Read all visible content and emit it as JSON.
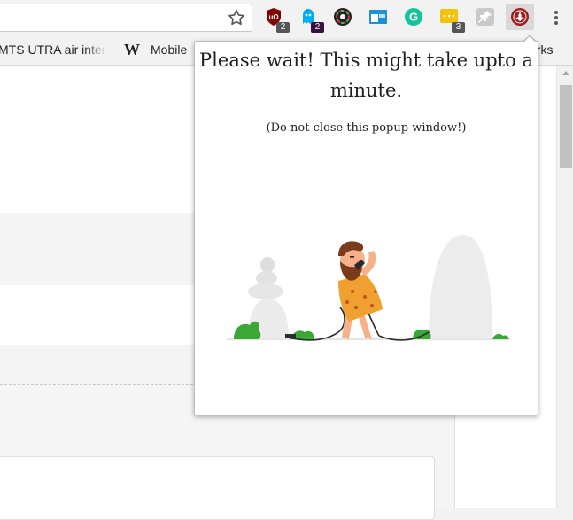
{
  "toolbar": {
    "bookmark_star": "star-icon",
    "extensions": [
      {
        "name": "ublock-origin",
        "badge": "2",
        "color": "#800000"
      },
      {
        "name": "ghostery",
        "badge": "2",
        "color": "#00aef0"
      },
      {
        "name": "color-picker",
        "badge": "",
        "color": "#222222"
      },
      {
        "name": "tab-tiler",
        "badge": "",
        "color": "#1e90d6"
      },
      {
        "name": "grammarly",
        "badge": "",
        "color": "#15c39a"
      },
      {
        "name": "chat-extension",
        "badge": "3",
        "color": "#f4c20d"
      },
      {
        "name": "pin-extension",
        "badge": "",
        "color": "#9e9e9e"
      },
      {
        "name": "active-extension",
        "badge": "",
        "color": "#a01c1c"
      }
    ]
  },
  "bookmarks": {
    "item1": "MTS UTRA air interf",
    "item2": "Mobile",
    "item3": "arks"
  },
  "popup": {
    "title": "Please wait! This might take upto a minute.",
    "note": "(Do not close this popup window!)"
  },
  "colors": {
    "accent_orange": "#f0a030",
    "skin": "#f6b08a",
    "bush_green": "#3aa835"
  }
}
